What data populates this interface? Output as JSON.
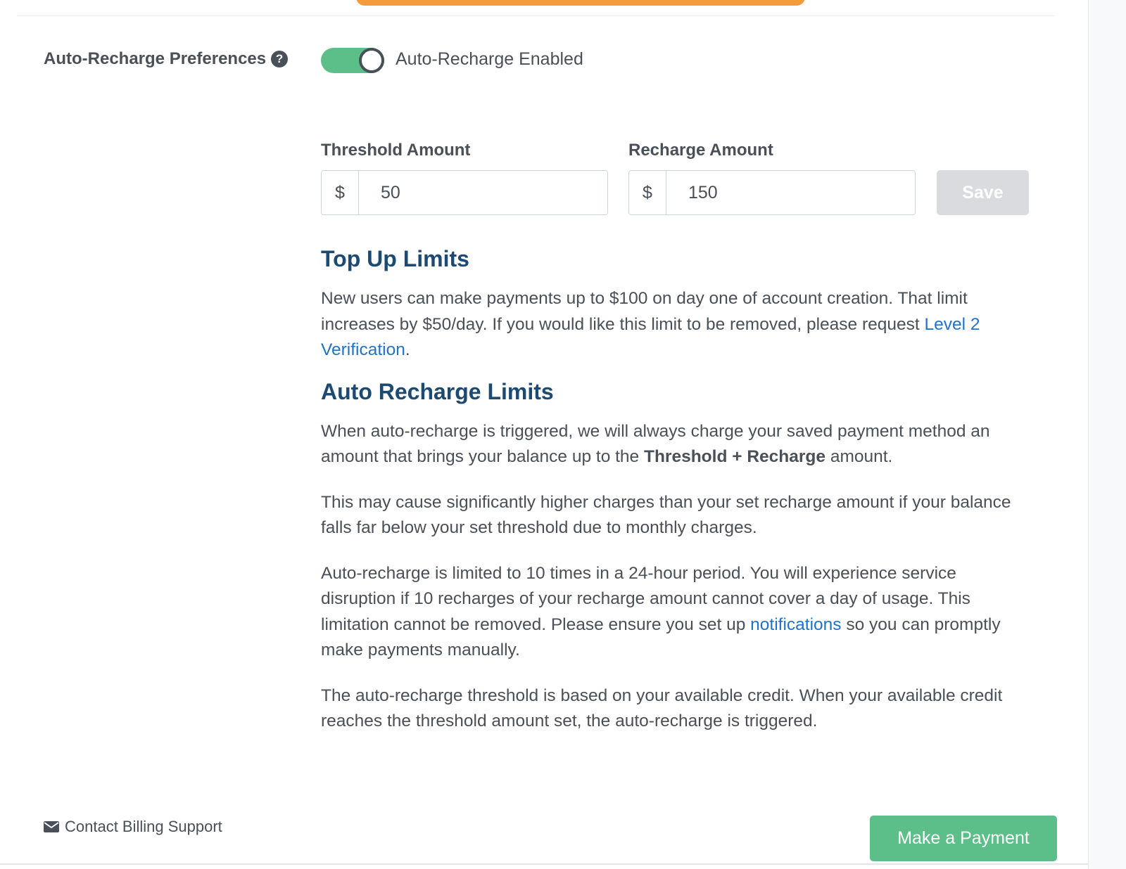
{
  "preferences": {
    "label": "Auto-Recharge Preferences",
    "help_icon": "question-circle-icon",
    "toggle_state": "on",
    "toggle_label": "Auto-Recharge Enabled"
  },
  "threshold": {
    "label": "Threshold Amount",
    "prefix": "$",
    "value": "50"
  },
  "recharge": {
    "label": "Recharge Amount",
    "prefix": "$",
    "value": "150"
  },
  "save_label": "Save",
  "top_up": {
    "title": "Top Up Limits",
    "text": "New users can make payments up to $100 on day one of account creation. That limit increases by $50/day. If you would like this limit to be removed, please request ",
    "link": "Level 2 Verification",
    "suffix": "."
  },
  "auto_limits": {
    "title": "Auto Recharge Limits",
    "p1_start": "When auto-recharge is triggered, we will always charge your saved payment method an amount that brings your balance up to the ",
    "p1_bold": "Threshold + Recharge",
    "p1_end": " amount.",
    "p2": "This may cause significantly higher charges than your set recharge amount if your balance falls far below your set threshold due to monthly charges.",
    "p3_start": "Auto-recharge is limited to 10 times in a 24-hour period. You will experience service disruption if 10 recharges of your recharge amount cannot cover a day of usage. This limitation cannot be removed. Please ensure you set up ",
    "p3_link": "notifications",
    "p3_end": " so you can promptly make payments manually.",
    "p4": "The auto-recharge threshold is based on your available credit. When your available credit reaches the threshold amount set, the auto-recharge is triggered."
  },
  "footer": {
    "support_icon": "envelope-icon",
    "support_label": "Contact Billing Support",
    "payment_label": "Make a Payment"
  },
  "colors": {
    "accent_green": "#5cbf8a",
    "heading_blue": "#1c4a72",
    "link_blue": "#1f73c9",
    "banner_orange": "#f39c3c"
  }
}
